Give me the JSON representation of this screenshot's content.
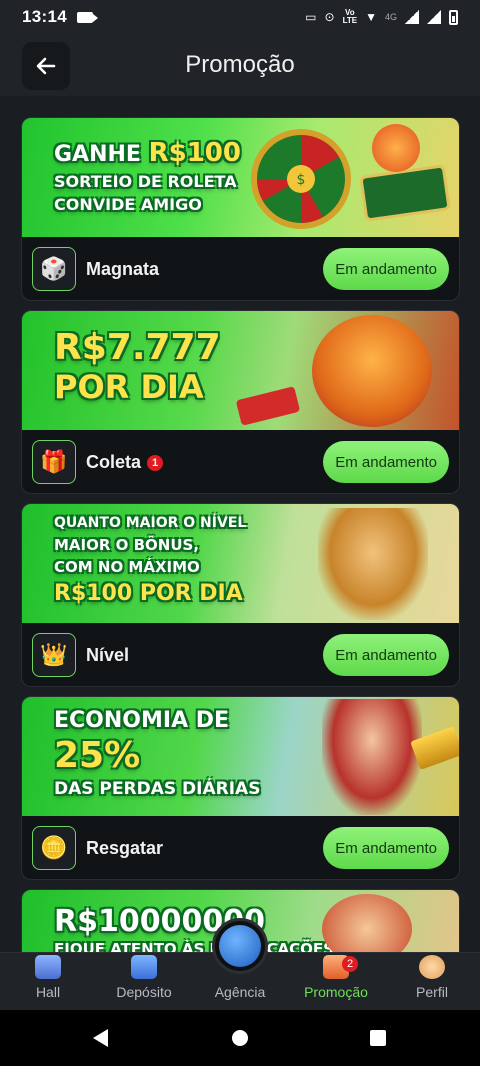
{
  "status_bar": {
    "time": "13:14",
    "network": "LTE",
    "network2": "4G"
  },
  "header": {
    "title": "Promoção"
  },
  "cards": [
    {
      "banner_lines": [
        "GANHE",
        "R$100",
        "SORTEIO DE ROLETA",
        "CONVIDE AMIGO"
      ],
      "label": "Magnata",
      "status": "Em andamento"
    },
    {
      "banner_lines": [
        "R$7.777",
        "POR DIA"
      ],
      "label": "Coleta",
      "badge": "1",
      "status": "Em andamento"
    },
    {
      "banner_lines": [
        "QUANTO MAIOR O NÍVEL",
        "MAIOR O BÔNUS,",
        "COM NO MÁXIMO",
        "R$100 POR DIA"
      ],
      "label": "Nível",
      "status": "Em andamento"
    },
    {
      "banner_lines": [
        "ECONOMIA DE",
        "25%",
        "DAS PERDAS DIÁRIAS"
      ],
      "label": "Resgatar",
      "status": "Em andamento"
    },
    {
      "banner_lines": [
        "R$10000000",
        "FIQUE ATENTO ÀS NOTIFICAÇÕES"
      ]
    }
  ],
  "tabs": [
    {
      "label": "Hall"
    },
    {
      "label": "Depósito"
    },
    {
      "label": "Agência"
    },
    {
      "label": "Promoção",
      "badge": "2"
    },
    {
      "label": "Perfil"
    }
  ],
  "colors": {
    "accent": "#6fe05a",
    "button": "#7de866",
    "badge": "#e01b22"
  }
}
